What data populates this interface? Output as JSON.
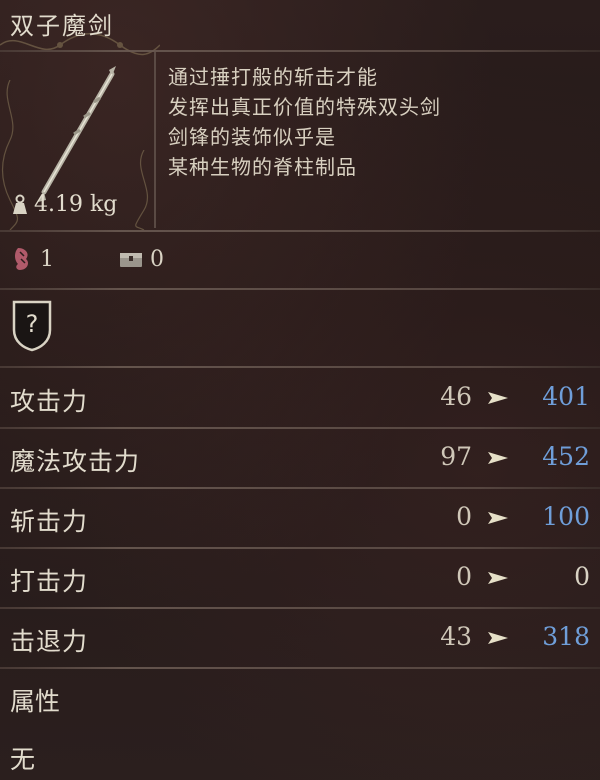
{
  "item": {
    "name": "双子魔剑",
    "weight": "4.19 kg",
    "description": [
      "通过捶打般的斩击才能",
      "发挥出真正价值的特殊双头剑",
      "剑锋的装饰似乎是",
      "某种生物的脊柱制品"
    ]
  },
  "counts": {
    "held": "1",
    "stored": "0"
  },
  "stats": [
    {
      "label": "攻击力",
      "base": "46",
      "upgraded": "401",
      "upgraded_color": "#6f9ed9"
    },
    {
      "label": "魔法攻击力",
      "base": "97",
      "upgraded": "452",
      "upgraded_color": "#6f9ed9"
    },
    {
      "label": "斩击力",
      "base": "0",
      "upgraded": "100",
      "upgraded_color": "#6f9ed9"
    },
    {
      "label": "打击力",
      "base": "0",
      "upgraded": "0",
      "upgraded_color": "#d9d3c4"
    },
    {
      "label": "击退力",
      "base": "43",
      "upgraded": "318",
      "upgraded_color": "#6f9ed9"
    }
  ],
  "attribute": {
    "label": "属性",
    "value": "无"
  },
  "icons": {
    "weight": "weight-icon",
    "held": "held-count-icon",
    "stored": "storage-chest-icon",
    "unknown": "unknown-shield-icon",
    "arrow": "arrow-right-icon"
  }
}
